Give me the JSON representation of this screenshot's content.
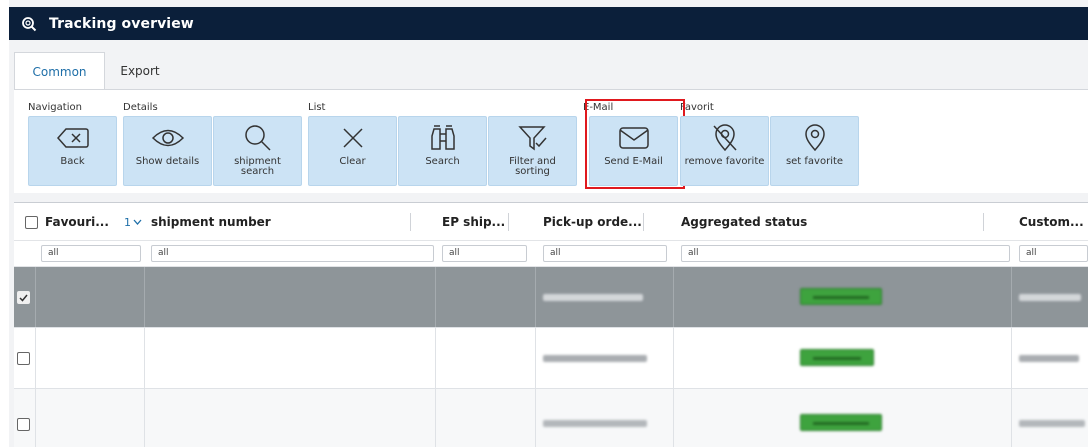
{
  "window": {
    "title": "Tracking overview",
    "icon": "zoom-search-icon"
  },
  "tabs": [
    {
      "label": "Common",
      "active": true
    },
    {
      "label": "Export",
      "active": false
    }
  ],
  "ribbon": {
    "groups": {
      "navigation": "Navigation",
      "details": "Details",
      "list": "List",
      "email": "E-Mail",
      "favorit": "Favorit"
    },
    "buttons": {
      "back": "Back",
      "show_details": "Show details",
      "shipment_search": "shipment\nsearch",
      "clear": "Clear",
      "search": "Search",
      "filter_sorting": "Filter and\nsorting",
      "send_email": "Send E-Mail",
      "remove_favorite": "remove favorite",
      "set_favorite": "set favorite"
    }
  },
  "grid": {
    "columns": {
      "favourite": "Favouri...",
      "sort_indicator": "1",
      "shipment_number": "shipment number",
      "ep_shipment": "EP ship...",
      "pickup_order": "Pick-up orde...",
      "aggregated_status": "Aggregated status",
      "customer": "Custom..."
    },
    "filter_placeholder": "all",
    "rows": [
      {
        "selected": true
      },
      {
        "selected": false
      },
      {
        "selected": false
      }
    ]
  },
  "colors": {
    "titlebar": "#0b1f3a",
    "ribbon_button": "#cce3f5",
    "highlight": "#e0191e",
    "selected_row": "#8e9599",
    "status_green": "#3ea33e",
    "tab_active_text": "#1f6fa8"
  }
}
